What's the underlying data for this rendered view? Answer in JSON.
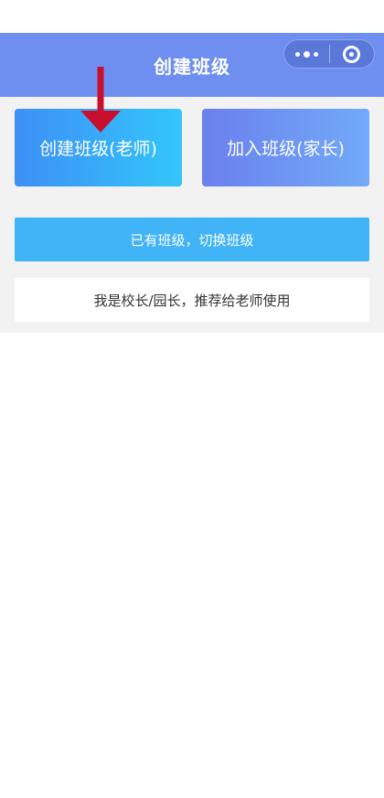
{
  "nav": {
    "title": "创建班级"
  },
  "capsule": {
    "more_icon": "more-dots-icon",
    "close_icon": "target-circle-icon"
  },
  "buttons": {
    "create_class": "创建班级(老师)",
    "join_class": "加入班级(家长)",
    "switch_class": "已有班级，切换班级",
    "recommend": "我是校长/园长，推荐给老师使用"
  },
  "colors": {
    "nav": "#6f8ff0",
    "create_gradient": [
      "#3d8ff5",
      "#33c6fb"
    ],
    "join_gradient": [
      "#6a80ee",
      "#72aaf8"
    ],
    "switch": "#41b4f8",
    "arrow": "#c8102e"
  }
}
